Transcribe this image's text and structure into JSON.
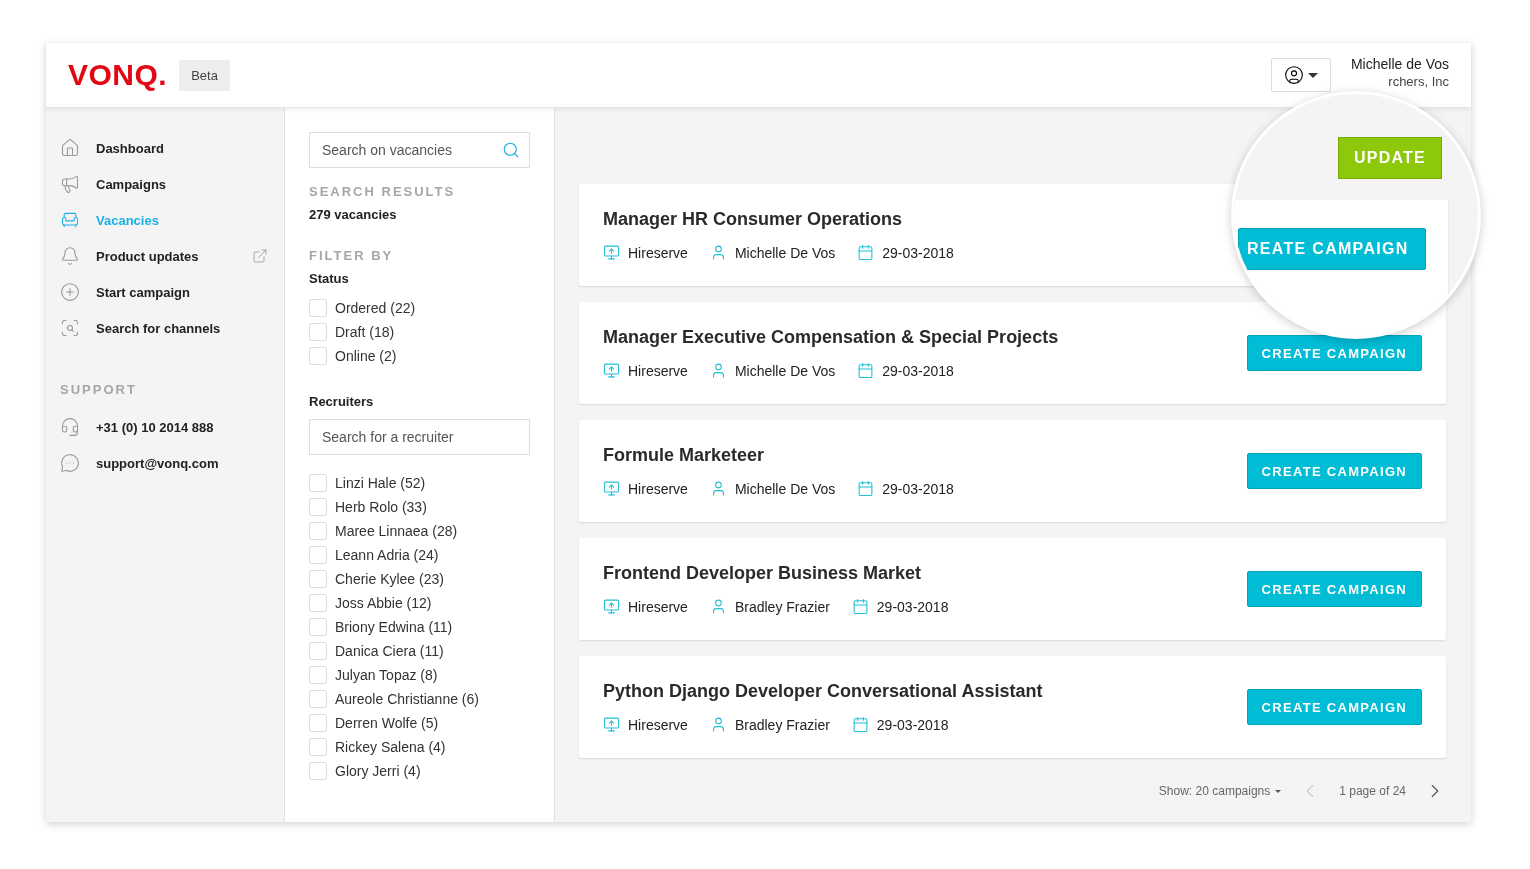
{
  "header": {
    "logo": "VONQ.",
    "badge": "Beta",
    "user_name": "Michelle de Vos",
    "user_company": "rchers, Inc"
  },
  "sidebar": {
    "items": [
      {
        "label": "Dashboard",
        "selected": false
      },
      {
        "label": "Campaigns",
        "selected": false
      },
      {
        "label": "Vacancies",
        "selected": true
      },
      {
        "label": "Product updates",
        "selected": false,
        "external": true
      },
      {
        "label": "Start campaign",
        "selected": false
      },
      {
        "label": "Search for channels",
        "selected": false
      }
    ],
    "support_title": "SUPPORT",
    "support": [
      {
        "kind": "phone",
        "label": "+31 (0) 10 2014 888"
      },
      {
        "kind": "chat",
        "label": "support@vonq.com"
      }
    ]
  },
  "filters": {
    "search": {
      "placeholder": "Search on vacancies"
    },
    "results_title": "SEARCH RESULTS",
    "results_count": "279 vacancies",
    "filter_title": "FILTER BY",
    "status_title": "Status",
    "status": [
      {
        "label": "Ordered (22)",
        "checked": false
      },
      {
        "label": "Draft (18)",
        "checked": false
      },
      {
        "label": "Online (2)",
        "checked": false
      }
    ],
    "recruiters_title": "Recruiters",
    "recruiter_search": {
      "placeholder": "Search for a recruiter"
    },
    "recruiters": [
      {
        "label": "Linzi Hale (52)",
        "checked": false
      },
      {
        "label": "Herb Rolo (33)",
        "checked": false
      },
      {
        "label": "Maree Linnaea (28)",
        "checked": false
      },
      {
        "label": "Leann Adria (24)",
        "checked": false
      },
      {
        "label": "Cherie Kylee (23)",
        "checked": false
      },
      {
        "label": "Joss Abbie (12)",
        "checked": false
      },
      {
        "label": "Briony Edwina (11)",
        "checked": false
      },
      {
        "label": "Danica Ciera (11)",
        "checked": false
      },
      {
        "label": "Julyan Topaz (8)",
        "checked": false
      },
      {
        "label": "Aureole Christianne (6)",
        "checked": false
      },
      {
        "label": "Derren Wolfe (5)",
        "checked": false
      },
      {
        "label": "Rickey Salena (4)",
        "checked": false
      },
      {
        "label": "Glory Jerri (4)",
        "checked": false
      }
    ]
  },
  "vacancies": [
    {
      "title": "Manager HR Consumer Operations",
      "company": "Hireserve",
      "recruiter": "Michelle De Vos",
      "date": "29-03-2018"
    },
    {
      "title": "Manager Executive Compensation & Special Projects",
      "company": "Hireserve",
      "recruiter": "Michelle De Vos",
      "date": "29-03-2018",
      "button": "CREATE CAMPAIGN"
    },
    {
      "title": "Formule Marketeer",
      "company": "Hireserve",
      "recruiter": "Michelle De Vos",
      "date": "29-03-2018",
      "button": "CREATE CAMPAIGN"
    },
    {
      "title": "Frontend Developer Business Market",
      "company": "Hireserve",
      "recruiter": "Bradley Frazier",
      "date": "29-03-2018",
      "button": "CREATE CAMPAIGN"
    },
    {
      "title": "Python Django Developer Conversational Assistant",
      "company": "Hireserve",
      "recruiter": "Bradley Frazier",
      "date": "29-03-2018",
      "button": "CREATE CAMPAIGN"
    }
  ],
  "magnifier": {
    "update_button": "UPDATE",
    "campaign_button": "REATE CAMPAIGN"
  },
  "pagination": {
    "show_label": "Show:",
    "per_page": "20 campaigns",
    "page_info": "1 page of 24",
    "prev_disabled": true
  }
}
